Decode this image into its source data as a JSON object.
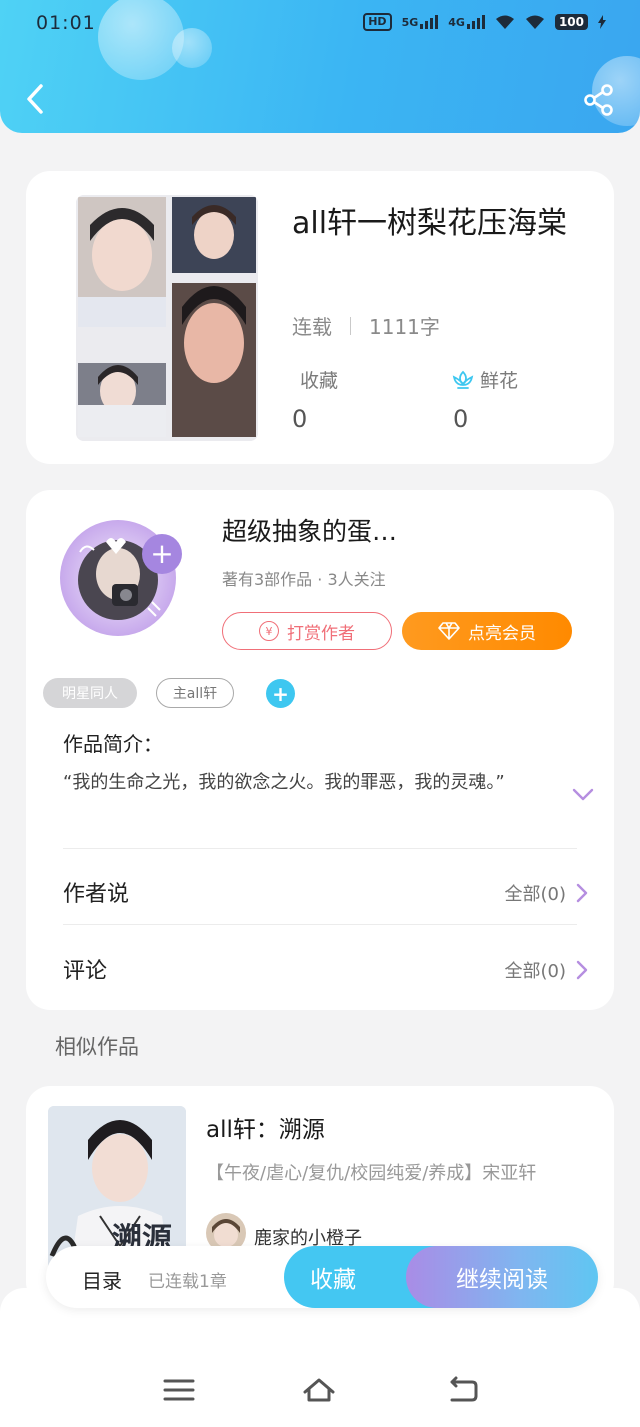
{
  "status_bar": {
    "time": "01:01",
    "network_hd": "HD",
    "network_5g": "5G",
    "network_4g": "4G",
    "battery": "100"
  },
  "header": {
    "back_icon": "chevron-left-icon",
    "share_icon": "share-icon",
    "accent": "#3bb5f3"
  },
  "book": {
    "title": "all轩一树梨花压海棠",
    "status": "连载",
    "word_count": "1111字",
    "favorites_label": "收藏",
    "favorites_value": "0",
    "flowers_label": "鲜花",
    "flowers_value": "0"
  },
  "author": {
    "name": "超级抽象的蛋…",
    "summary": "著有3部作品 · 3人关注",
    "tip_label": "打赏作者",
    "vip_label": "点亮会员",
    "tags": [
      "明星同人",
      "主all轩"
    ]
  },
  "intro": {
    "label": "作品简介：",
    "text": "“我的生命之光，我的欲念之火。我的罪恶，我的灵魂。”"
  },
  "rows": {
    "author_says_label": "作者说",
    "author_says_count": "全部(0)",
    "comments_label": "评论",
    "comments_count": "全部(0)"
  },
  "similar": {
    "section_title": "相似作品",
    "title": "all轩：溯源",
    "description": "【午夜/虐心/复仇/校园纯爱/养成】宋亚轩",
    "author": "鹿家的小橙子",
    "cover_text": "溯源"
  },
  "action_bar": {
    "catalog": "目录",
    "updates": "已连载1章",
    "collect": "收藏",
    "continue_reading": "继续阅读"
  },
  "colors": {
    "tip": "#f06f78",
    "vip": "#ff9a1f",
    "collect": "#44c7f2",
    "chevron": "#b58ee0"
  }
}
